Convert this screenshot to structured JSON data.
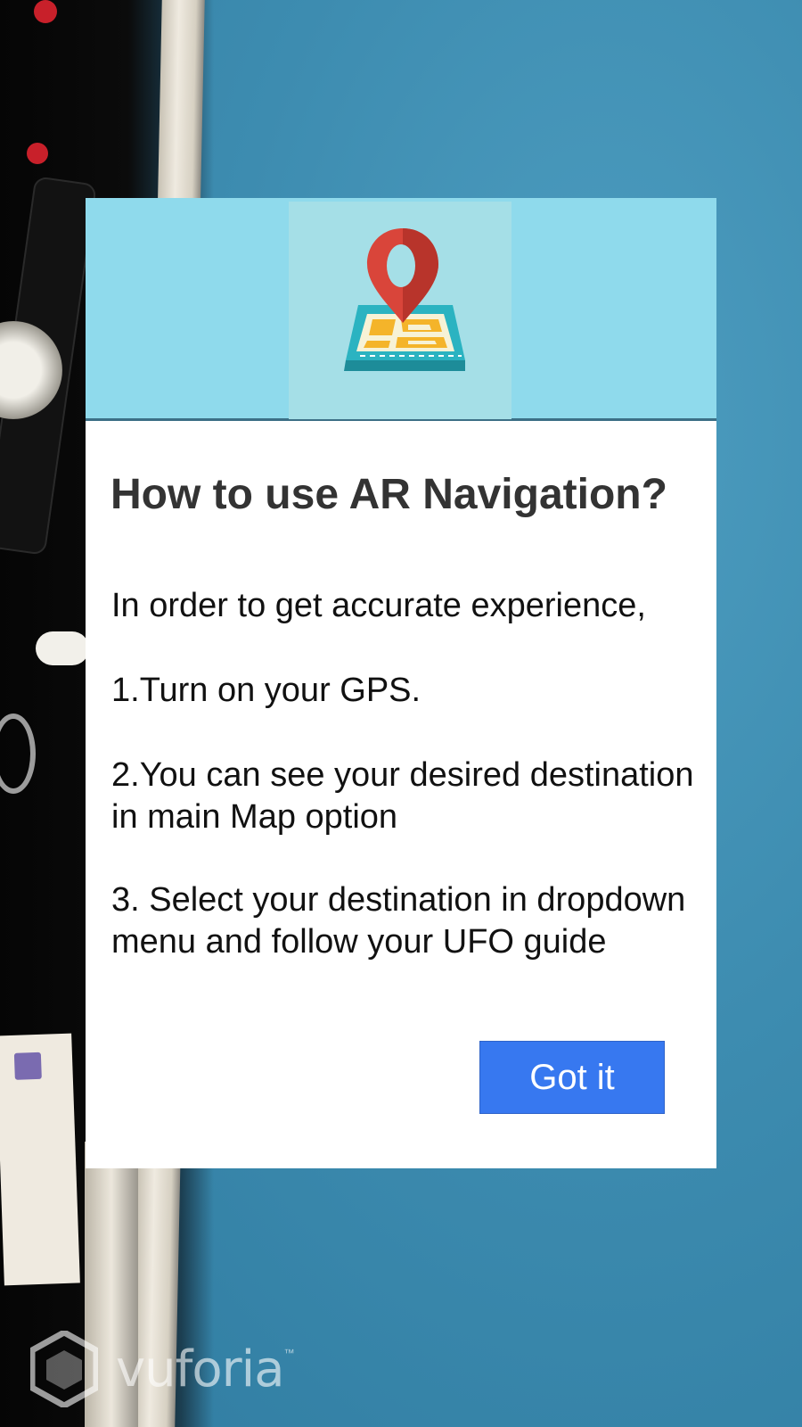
{
  "dialog": {
    "title": "How to use AR Navigation?",
    "intro": "In order to get accurate experience,",
    "steps": [
      "1.Turn on your GPS.",
      "2.You can see your desired destination  in main Map option",
      "3. Select your destination in dropdown menu and follow your UFO guide"
    ],
    "button_label": "Got it",
    "header_icon": "map-pin-icon"
  },
  "watermark": {
    "brand": "vuforia",
    "trademark": "™"
  },
  "colors": {
    "header_bg": "#8fdaec",
    "button_bg": "#3778f0",
    "title_text": "#333333"
  }
}
